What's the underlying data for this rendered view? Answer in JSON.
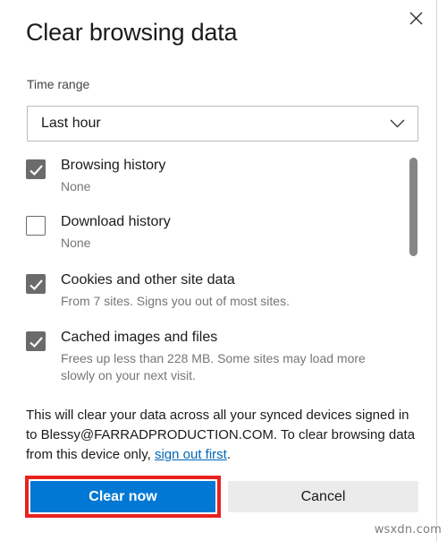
{
  "dialog": {
    "title": "Clear browsing data",
    "close_icon": "close-icon"
  },
  "time_range": {
    "label": "Time range",
    "selected": "Last hour",
    "chevron_icon": "chevron-down-icon"
  },
  "options": [
    {
      "id": "browsing-history",
      "title": "Browsing history",
      "sub": "None",
      "checked": true
    },
    {
      "id": "download-history",
      "title": "Download history",
      "sub": "None",
      "checked": false
    },
    {
      "id": "cookies-and-other-site-data",
      "title": "Cookies and other site data",
      "sub": "From 7 sites. Signs you out of most sites.",
      "checked": true
    },
    {
      "id": "cached-images-and-files",
      "title": "Cached images and files",
      "sub": "Frees up less than 228 MB. Some sites may load more slowly on your next visit.",
      "checked": true
    }
  ],
  "sync_note": {
    "before_link": "This will clear your data across all your synced devices signed in to Blessy@FARRADPRODUCTION.COM. To clear browsing data from this device only, ",
    "link_text": "sign out first",
    "after_link": "."
  },
  "footer": {
    "clear_now_label": "Clear now",
    "cancel_label": "Cancel"
  },
  "watermark": "wsxdn.com",
  "colors": {
    "accent": "#0078d4",
    "highlight_outline": "#e8221f",
    "link": "#0067b8",
    "checkbox_fill": "#6b6b6b",
    "cancel_bg": "#ebebeb",
    "scrollbar_thumb": "#868686"
  }
}
